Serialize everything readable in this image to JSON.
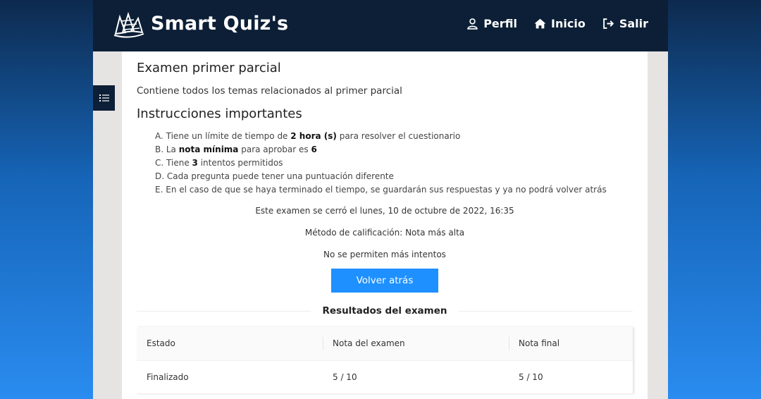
{
  "header": {
    "brand": "Smart Quiz's",
    "nav": [
      {
        "label": "Perfil",
        "icon": "user-icon"
      },
      {
        "label": "Inicio",
        "icon": "home-icon"
      },
      {
        "label": "Salir",
        "icon": "logout-icon"
      }
    ]
  },
  "exam": {
    "title": "Examen primer parcial",
    "description": "Contiene todos los temas relacionados al primer parcial"
  },
  "instructions": {
    "title": "Instrucciones importantes",
    "items": {
      "a": {
        "marker": "A.",
        "pre": "Tiene un límite de tiempo de ",
        "bold": "2 hora (s)",
        "post": " para resolver el cuestionario"
      },
      "b": {
        "marker": "B.",
        "pre": "La ",
        "bold": "nota mínima",
        "mid": " para aprobar es ",
        "bold2": "6"
      },
      "c": {
        "marker": "C.",
        "pre": "Tiene ",
        "bold": "3",
        "post": " intentos permitidos"
      },
      "d": {
        "marker": "D.",
        "text": "Cada pregunta puede tener una puntuación diferente"
      },
      "e": {
        "marker": "E.",
        "text": "En el caso de que se haya terminado el tiempo, se guardarán sus respuestas y ya no podrá volver atrás"
      }
    }
  },
  "status": {
    "closed": "Este examen se cerró el lunes, 10 de octubre de 2022, 16:35",
    "grading": "Método de calificación: Nota más alta",
    "attempts": "No se permiten más intentos"
  },
  "back_button": "Volver atrás",
  "results": {
    "title": "Resultados del examen",
    "columns": [
      "Estado",
      "Nota del examen",
      "Nota final"
    ],
    "rows": [
      [
        "Finalizado",
        "5 / 10",
        "5 / 10"
      ]
    ]
  },
  "colors": {
    "topbar": "#0c1f36",
    "primary_button": "#1e90ff"
  }
}
